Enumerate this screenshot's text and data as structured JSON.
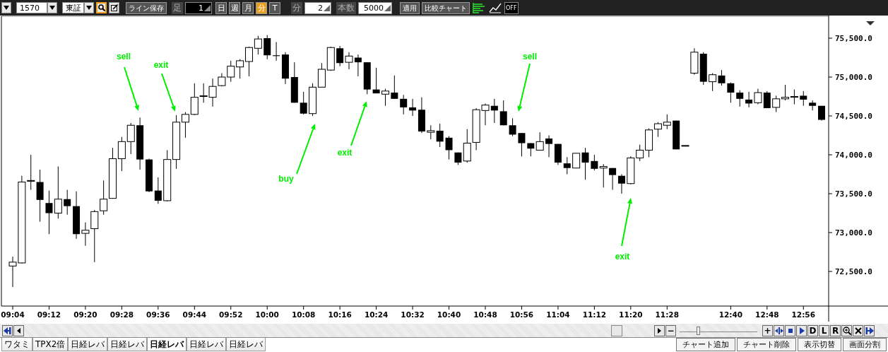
{
  "toolbar": {
    "symbol_field": {
      "value": "1570"
    },
    "market_field": {
      "value": "東証"
    },
    "search_on": true,
    "save_line_button": "ライン保存",
    "bar_label": "足",
    "bar_field": {
      "value": "1"
    },
    "periods": [
      {
        "label": "日",
        "selected": false
      },
      {
        "label": "週",
        "selected": false
      },
      {
        "label": "月",
        "selected": false
      },
      {
        "label": "分",
        "selected": true
      },
      {
        "label": "T",
        "selected": false
      }
    ],
    "unit_label": "分",
    "interval_field": {
      "value": "2"
    },
    "count_label": "本数",
    "count_field": {
      "value": "5000"
    },
    "apply_button": "適用",
    "compare_button": "比較チャート",
    "off_button": "OFF"
  },
  "chart": {
    "chart_data": {
      "type": "candlestick",
      "ylim": [
        72055,
        75791
      ],
      "yticks": [
        {
          "value": 75500,
          "label": "75,500.0"
        },
        {
          "value": 75000,
          "label": "75,000.0"
        },
        {
          "value": 74500,
          "label": "74,500.0"
        },
        {
          "value": 74000,
          "label": "74,000.0"
        },
        {
          "value": 73500,
          "label": "73,500.0"
        },
        {
          "value": 73000,
          "label": "73,000.0"
        },
        {
          "value": 72500,
          "label": "72,500.0"
        }
      ],
      "categories": [
        "09:04",
        null,
        null,
        null,
        "09:12",
        null,
        null,
        null,
        "09:20",
        null,
        null,
        null,
        "09:28",
        null,
        null,
        null,
        "09:36",
        null,
        null,
        null,
        "09:44",
        null,
        null,
        null,
        "09:52",
        null,
        null,
        null,
        "10:00",
        null,
        null,
        null,
        "10:08",
        null,
        null,
        null,
        "10:16",
        null,
        null,
        null,
        "10:24",
        null,
        null,
        null,
        "10:32",
        null,
        null,
        null,
        "10:40",
        null,
        null,
        null,
        "10:48",
        null,
        null,
        null,
        "10:56",
        null,
        null,
        null,
        "11:04",
        null,
        null,
        null,
        "11:12",
        null,
        null,
        null,
        "11:20",
        null,
        null,
        null,
        "11:28",
        null,
        null,
        null,
        null,
        null,
        null,
        "12:40",
        null,
        null,
        null,
        "12:48",
        null,
        null,
        null,
        "12:56",
        null,
        null
      ],
      "ohlc": [
        [
          72570,
          72690,
          72300,
          72620
        ],
        [
          72610,
          73730,
          72600,
          73650
        ],
        [
          73660,
          74000,
          73550,
          73670
        ],
        [
          73650,
          73810,
          73140,
          73420
        ],
        [
          73380,
          73540,
          72980,
          73250
        ],
        [
          73250,
          73850,
          73180,
          73430
        ],
        [
          73430,
          73550,
          73230,
          73340
        ],
        [
          73340,
          73530,
          72920,
          72980
        ],
        [
          72990,
          73130,
          72830,
          73030
        ],
        [
          73050,
          73290,
          72620,
          73270
        ],
        [
          73280,
          73670,
          73230,
          73430
        ],
        [
          73440,
          74090,
          73440,
          73950
        ],
        [
          73950,
          74230,
          73790,
          74170
        ],
        [
          74170,
          74410,
          74010,
          74380
        ],
        [
          74380,
          74480,
          73810,
          73940
        ],
        [
          73940,
          73950,
          73520,
          73530
        ],
        [
          73540,
          73710,
          73370,
          73410
        ],
        [
          73410,
          74060,
          73400,
          73940
        ],
        [
          73940,
          74510,
          73820,
          74420
        ],
        [
          74420,
          74550,
          74220,
          74520
        ],
        [
          74520,
          74920,
          74510,
          74740
        ],
        [
          74750,
          74920,
          74670,
          74760
        ],
        [
          74740,
          74980,
          74620,
          74880
        ],
        [
          74890,
          75050,
          74880,
          75000
        ],
        [
          75000,
          75210,
          74940,
          75140
        ],
        [
          75130,
          75230,
          74980,
          75210
        ],
        [
          75200,
          75390,
          75010,
          75380
        ],
        [
          75370,
          75530,
          75290,
          75490
        ],
        [
          75500,
          75540,
          75230,
          75280
        ],
        [
          75280,
          75450,
          75210,
          75270
        ],
        [
          75290,
          75320,
          74910,
          74980
        ],
        [
          75000,
          75190,
          74670,
          74670
        ],
        [
          74670,
          74810,
          74520,
          74530
        ],
        [
          74530,
          74920,
          74500,
          74870
        ],
        [
          74870,
          75180,
          74870,
          75100
        ],
        [
          75090,
          75390,
          75080,
          75380
        ],
        [
          75370,
          75400,
          75140,
          75180
        ],
        [
          75190,
          75320,
          75100,
          75270
        ],
        [
          75250,
          75290,
          75010,
          75190
        ],
        [
          75190,
          75190,
          74780,
          74840
        ],
        [
          74840,
          75120,
          74790,
          74790
        ],
        [
          74780,
          74850,
          74630,
          74820
        ],
        [
          74800,
          75020,
          74720,
          74720
        ],
        [
          74720,
          74770,
          74520,
          74610
        ],
        [
          74610,
          74720,
          74500,
          74570
        ],
        [
          74580,
          74740,
          74280,
          74300
        ],
        [
          74290,
          74380,
          74200,
          74310
        ],
        [
          74310,
          74400,
          74100,
          74170
        ],
        [
          74220,
          74240,
          73940,
          74060
        ],
        [
          74030,
          74030,
          73870,
          73900
        ],
        [
          73920,
          74330,
          73900,
          74150
        ],
        [
          74160,
          74600,
          74060,
          74580
        ],
        [
          74570,
          74660,
          74380,
          74640
        ],
        [
          74630,
          74720,
          74410,
          74570
        ],
        [
          74560,
          74700,
          74380,
          74380
        ],
        [
          74380,
          74470,
          74240,
          74260
        ],
        [
          74280,
          74280,
          73980,
          74150
        ],
        [
          74150,
          74150,
          73980,
          74080
        ],
        [
          74060,
          74290,
          74060,
          74170
        ],
        [
          74210,
          74250,
          73970,
          74140
        ],
        [
          74140,
          74140,
          73870,
          73900
        ],
        [
          73890,
          73970,
          73750,
          73830
        ],
        [
          73830,
          74020,
          73830,
          74020
        ],
        [
          74030,
          74090,
          73680,
          73900
        ],
        [
          73920,
          74000,
          73800,
          73820
        ],
        [
          73830,
          73880,
          73580,
          73850
        ],
        [
          73830,
          73830,
          73550,
          73740
        ],
        [
          73730,
          73750,
          73500,
          73630
        ],
        [
          73630,
          73980,
          73620,
          73960
        ],
        [
          73960,
          74130,
          73920,
          74060
        ],
        [
          74060,
          74340,
          73970,
          74320
        ],
        [
          74330,
          74420,
          74230,
          74400
        ],
        [
          74380,
          74520,
          74330,
          74420
        ],
        [
          74440,
          74440,
          74070,
          74070
        ],
        [
          74120,
          74120,
          74120,
          74120
        ],
        [
          75050,
          75370,
          75030,
          75320
        ],
        [
          75300,
          75320,
          74900,
          74940
        ],
        [
          74940,
          75050,
          74820,
          75030
        ],
        [
          75020,
          75090,
          74890,
          74920
        ],
        [
          74920,
          74930,
          74670,
          74800
        ],
        [
          74800,
          74830,
          74620,
          74720
        ],
        [
          74710,
          74810,
          74610,
          74660
        ],
        [
          74670,
          74850,
          74650,
          74800
        ],
        [
          74800,
          74820,
          74600,
          74600
        ],
        [
          74610,
          74760,
          74550,
          74720
        ],
        [
          74720,
          74900,
          74700,
          74740
        ],
        [
          74740,
          74840,
          74650,
          74750
        ],
        [
          74760,
          74820,
          74630,
          74710
        ],
        [
          74670,
          74700,
          74570,
          74630
        ],
        [
          74630,
          74630,
          74440,
          74450
        ]
      ],
      "annotations": [
        "sell",
        "exit",
        "buy",
        "exit",
        "sell",
        "exit"
      ]
    }
  },
  "scroll": {
    "minus_button": "−",
    "zoom_slider": {
      "level": 0.22
    },
    "tool_buttons": [
      {
        "kind": "text",
        "label": "+"
      },
      {
        "kind": "move"
      },
      {
        "kind": "stop"
      },
      {
        "kind": "play"
      },
      {
        "kind": "text",
        "label": "D"
      },
      {
        "kind": "text",
        "label": "L"
      },
      {
        "kind": "text",
        "label": "R"
      },
      {
        "kind": "zoom"
      },
      {
        "kind": "close"
      },
      {
        "kind": "last"
      }
    ]
  },
  "tabs": [
    {
      "label": "ワタミ",
      "selected": false
    },
    {
      "label": "TPX2倍",
      "selected": false
    },
    {
      "label": "日経レバ",
      "selected": false
    },
    {
      "label": "日経レバ",
      "selected": false
    },
    {
      "label": "日経レバ",
      "selected": true
    },
    {
      "label": "日経レバ",
      "selected": false
    },
    {
      "label": "日経レバ",
      "selected": false
    }
  ],
  "actions": [
    "チャート追加",
    "チャート削除",
    "表示切替",
    "画面分割"
  ]
}
